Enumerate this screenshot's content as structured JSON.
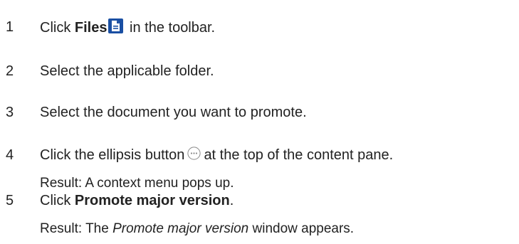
{
  "steps": [
    {
      "number": "1",
      "before": "Click ",
      "bold": "Files",
      "after": " in the toolbar.",
      "icon": "file-document-icon"
    },
    {
      "number": "2",
      "text": "Select the applicable folder."
    },
    {
      "number": "3",
      "text": "Select the document you want to promote."
    },
    {
      "number": "4",
      "before": "Click the ellipsis button",
      "after": "at the top of the content pane.",
      "icon": "ellipsis-icon",
      "result": "Result: A context menu pops up."
    },
    {
      "number": "5",
      "before": "Click ",
      "bold": "Promote major version",
      "after": ".",
      "result_before": "Result: The ",
      "result_italic": "Promote major version",
      "result_after": " window appears."
    }
  ],
  "colors": {
    "icon_blue": "#1a4fa3",
    "ellipsis_gray": "#8a8a8a",
    "text": "#222222"
  }
}
